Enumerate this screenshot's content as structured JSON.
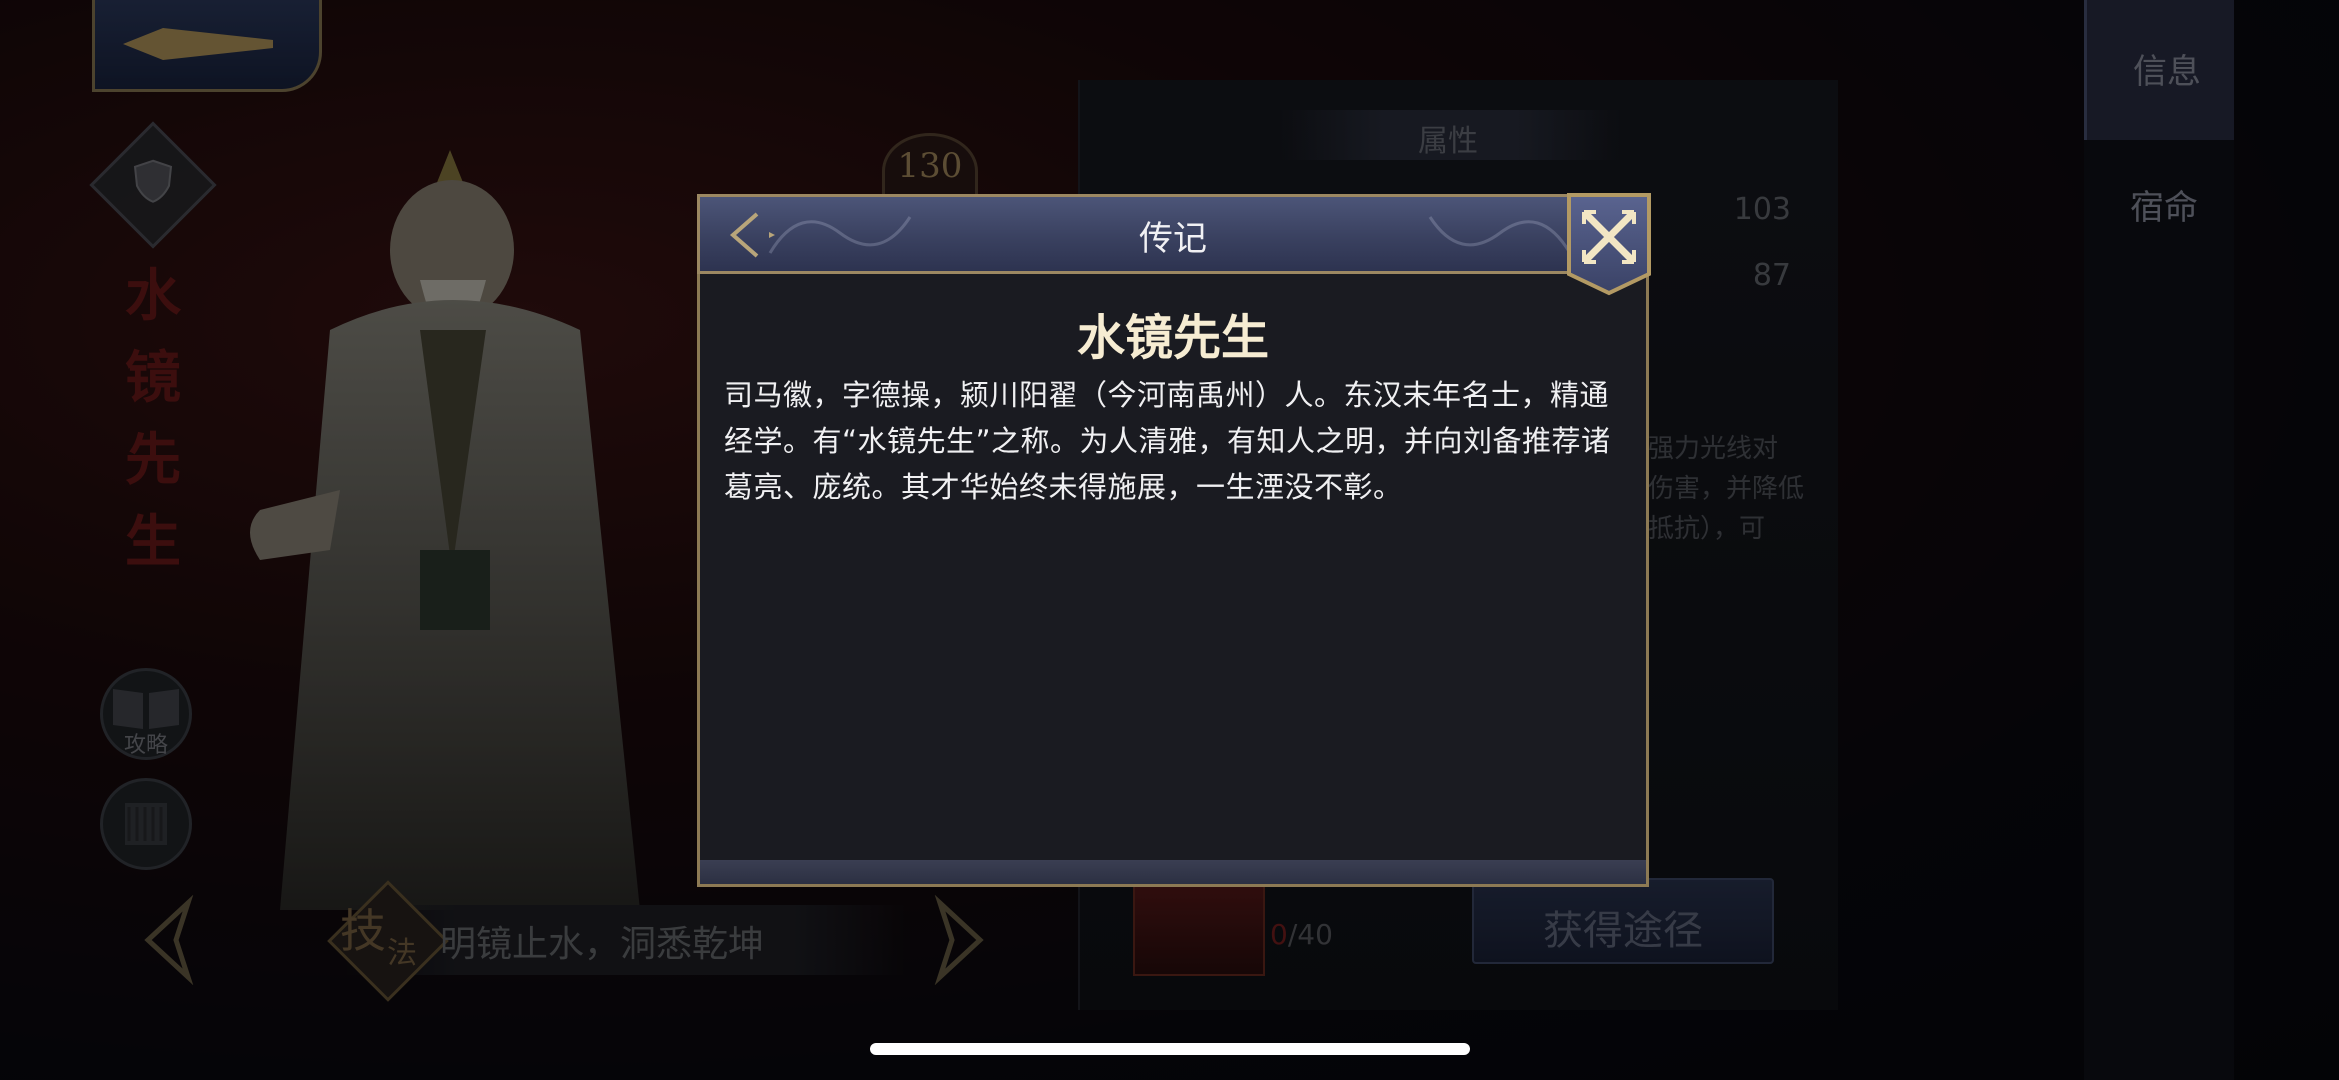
{
  "hero": {
    "name": "水镜先生",
    "level": "130",
    "skill_char_1": "技",
    "skill_char_2": "法",
    "skill_text": "明镜止水，洞悉乾坤",
    "strategy_label": "攻略"
  },
  "info_panel": {
    "section_title": "属性",
    "stats": [
      "103",
      "87"
    ],
    "desc_lines": [
      "强力光线对",
      "伤害，并降低",
      "抵抗），可"
    ],
    "fragment_current": "0",
    "fragment_total": "/40",
    "acquire_button": "获得途径"
  },
  "side_tabs": [
    {
      "label": "信息"
    },
    {
      "label": "宿命"
    }
  ],
  "modal": {
    "header_title": "传记",
    "name": "水镜先生",
    "body": "司马徽，字德操，颍川阳翟（今河南禹州）人。东汉末年名士，精通经学。有“水镜先生”之称。为人清雅，有知人之明，并向刘备推荐诸葛亮、庞统。其才华始终未得施展，一生湮没不彰。"
  },
  "colors": {
    "accent_gold": "#8d7a54",
    "header_blue": "#3a4160",
    "modal_bg": "#1a1b21",
    "hero_name_red": "#6e1a1a"
  },
  "icons": [
    "back-arrow-icon",
    "shield-icon",
    "strategy-book-icon",
    "scroll-icon",
    "prev-arrow-icon",
    "next-arrow-icon",
    "close-icon",
    "back-chevron-icon"
  ]
}
